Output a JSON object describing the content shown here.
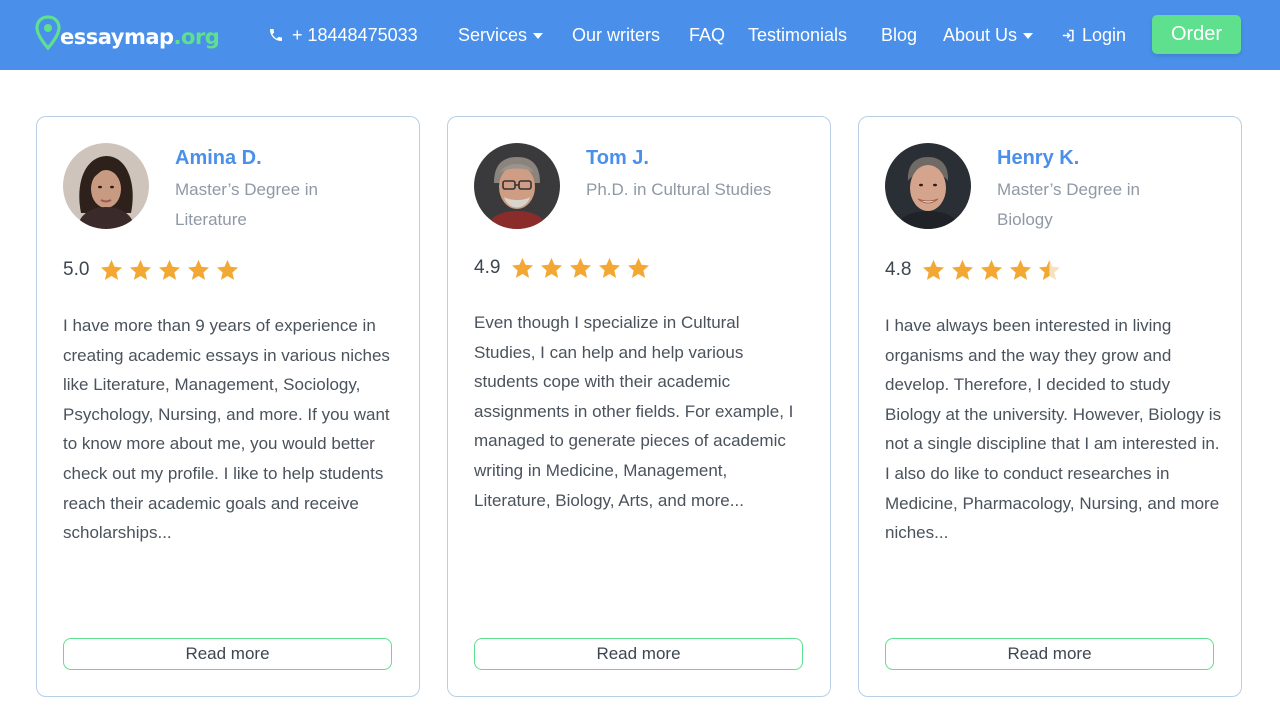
{
  "header": {
    "logo": {
      "name": "essaymap",
      "tld": ".org"
    },
    "phone": "+ 18448475033",
    "nav": [
      {
        "label": "Services",
        "has_dropdown": true
      },
      {
        "label": "Our writers",
        "has_dropdown": false
      },
      {
        "label": "FAQ",
        "has_dropdown": false
      },
      {
        "label": "Testimonials",
        "has_dropdown": false
      },
      {
        "label": "Blog",
        "has_dropdown": false
      },
      {
        "label": "About Us",
        "has_dropdown": true
      }
    ],
    "login_label": "Login",
    "order_label": "Order",
    "icons": {
      "phone": "phone-icon",
      "login": "login-icon",
      "logo": "location-pin-icon"
    }
  },
  "writers": [
    {
      "name": "Amina D.",
      "degree": "Master’s Degree in Literature",
      "rating": "5.0",
      "stars": 5,
      "bio": "I have more than 9 years of experience in creating academic essays in various niches like Literature, Management, Sociology, Psychology, Nursing, and more. If you want to know more about me, you would better check out my profile. I like to help students reach their academic goals and receive scholarships...",
      "read_more": "Read more"
    },
    {
      "name": "Tom J.",
      "degree": "Ph.D. in Cultural Studies",
      "rating": "4.9",
      "stars": 5,
      "bio": "Even though I specialize in Cultural Studies, I can help and help various students cope with their academic assignments in other fields. For example, I managed to generate pieces of academic writing in Medicine, Management, Literature, Biology, Arts, and more...",
      "read_more": "Read more"
    },
    {
      "name": "Henry K.",
      "degree": "Master’s Degree in Biology",
      "rating": "4.8",
      "stars": 4.5,
      "bio": "I have always been interested in living organisms and the way they grow and develop. Therefore, I decided to study Biology at the university. However, Biology is not a single discipline that I am interested in. I also do like to conduct researches in Medicine, Pharmacology, Nursing, and more niches...",
      "read_more": "Read more"
    }
  ],
  "colors": {
    "header_bg": "#4a90ea",
    "accent_green": "#5ee08e",
    "name_blue": "#4a90ea",
    "star": "#f3a833",
    "card_border": "#b9cfe6"
  }
}
